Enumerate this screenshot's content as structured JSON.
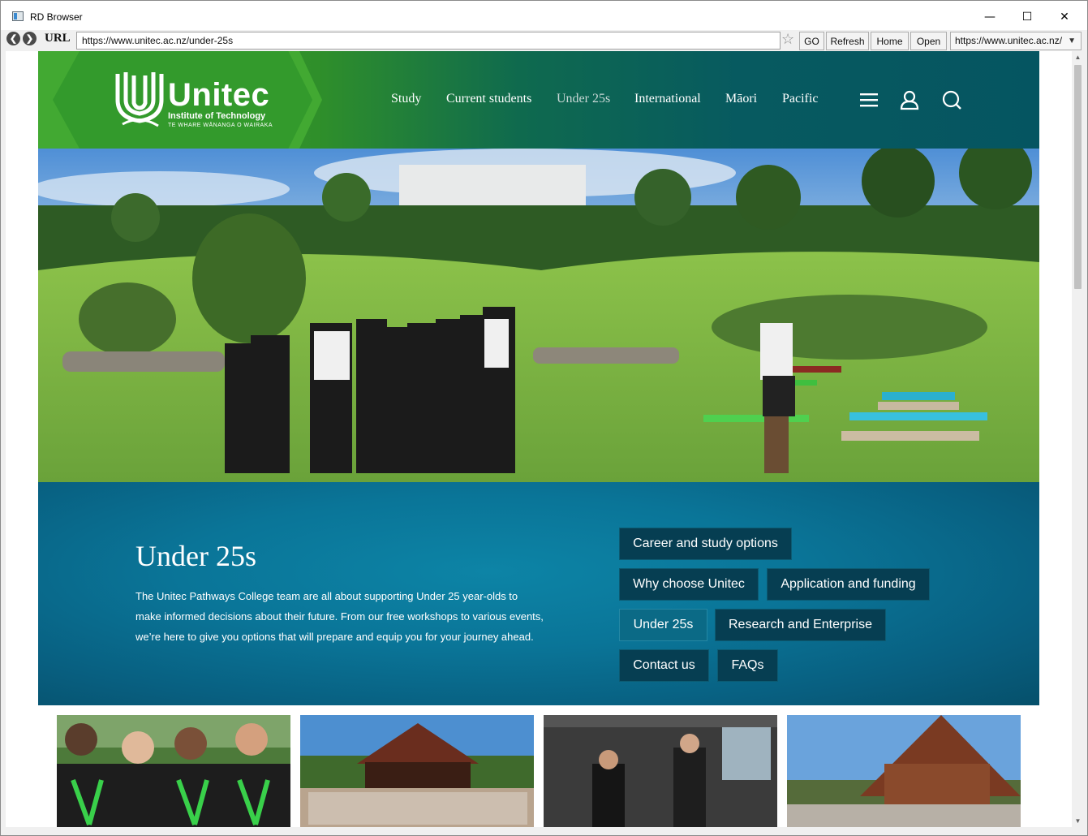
{
  "window": {
    "title": "RD Browser",
    "minimize_glyph": "—",
    "maximize_glyph": "☐",
    "close_glyph": "✕"
  },
  "toolbar": {
    "back_glyph": "❮",
    "forward_glyph": "❯",
    "url_label": "URL",
    "url_value": "https://www.unitec.ac.nz/under-25s",
    "bookmark_glyph": "☆",
    "go_label": "GO",
    "refresh_label": "Refresh",
    "home_label": "Home",
    "open_label": "Open",
    "history_selected": "https://www.unitec.ac.nz/",
    "dropdown_glyph": "▼"
  },
  "site": {
    "logo": {
      "wordmark": "Unitec",
      "subtitle": "Institute of Technology",
      "maori_subtitle": "TE WHARE WĀNANGA O WAIRAKA"
    },
    "nav": [
      "Study",
      "Current students",
      "Under 25s",
      "International",
      "Māori",
      "Pacific"
    ],
    "active_nav": "Under 25s",
    "icons": [
      "menu-icon",
      "account-icon",
      "search-icon"
    ],
    "colors": {
      "green": "#3a9a2e",
      "teal": "#055561",
      "promo": "#0a7598",
      "pill": "#063e52"
    }
  },
  "promo": {
    "title": "Under 25s",
    "body": "The Unitec Pathways College team are all about supporting Under 25 year-olds to make informed decisions about their future. From our free workshops to various events, we’re here to give you options that will prepare and equip you for your journey ahead.",
    "buttons": [
      "Career and study options",
      "Why choose Unitec",
      "Application and funding",
      "Under 25s",
      "Research and Enterprise",
      "Contact us",
      "FAQs"
    ]
  },
  "scrollbar": {
    "up_glyph": "▲",
    "down_glyph": "▼"
  }
}
